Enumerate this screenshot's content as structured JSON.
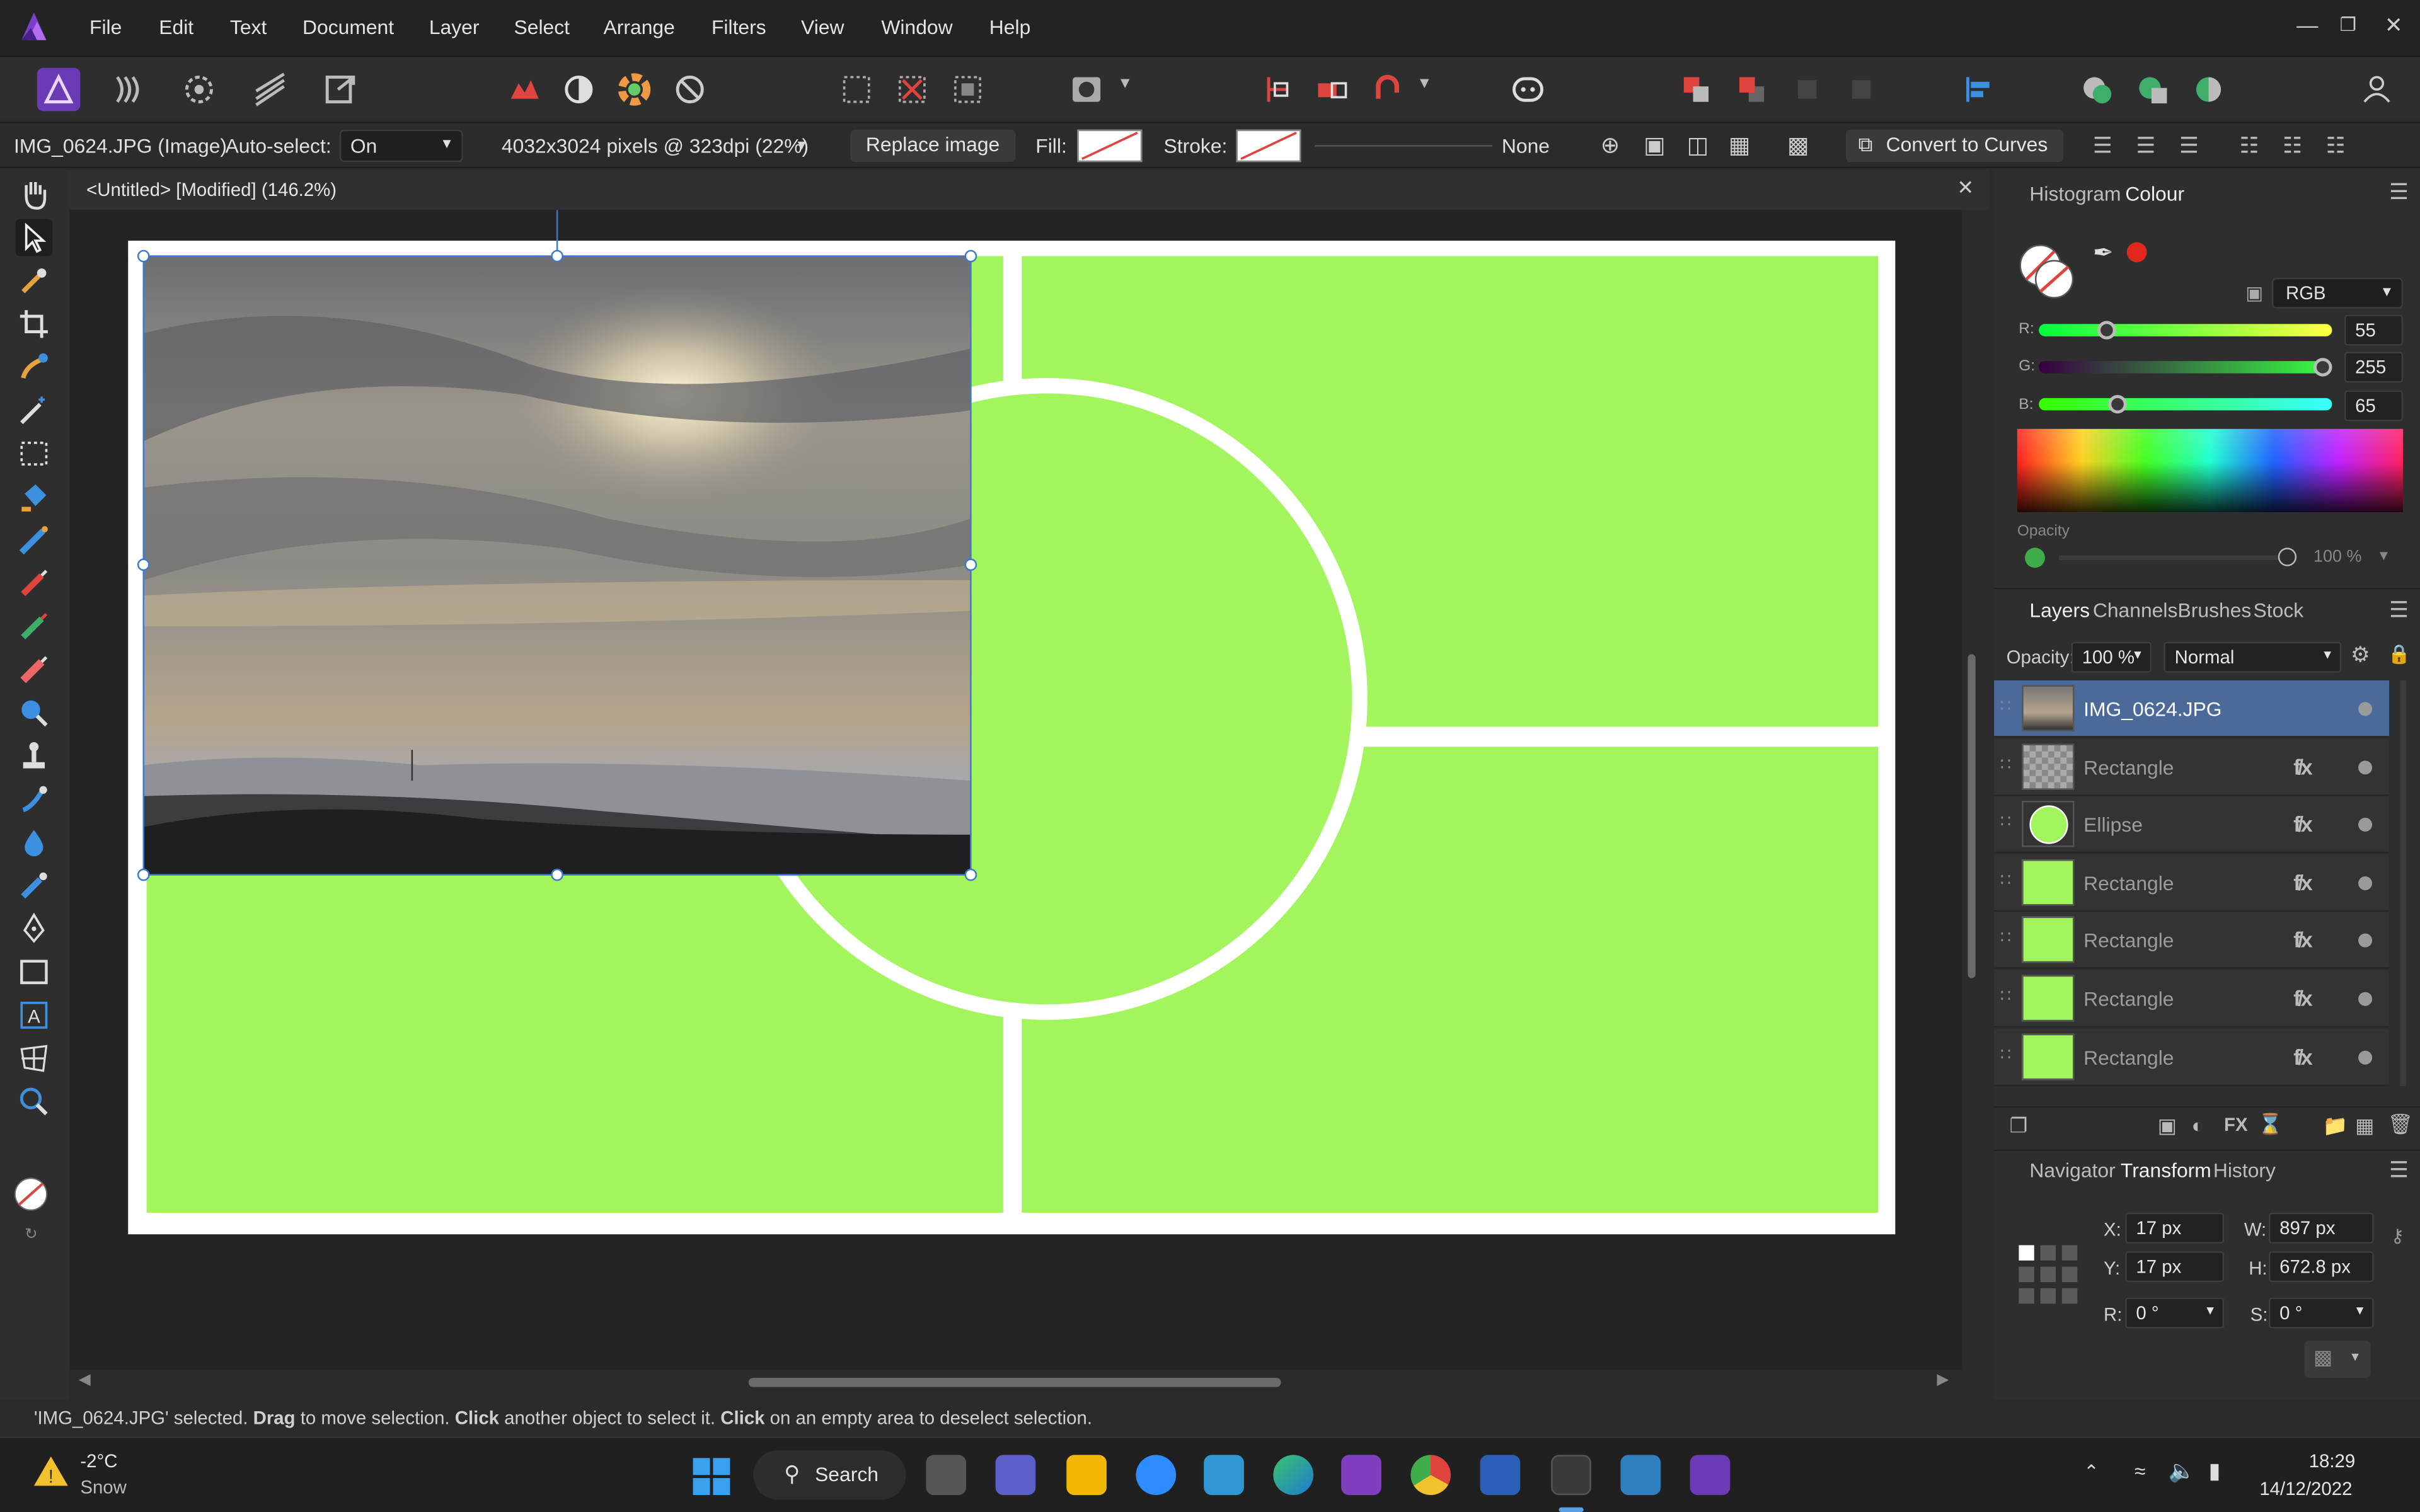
{
  "app": {
    "menu": [
      "File",
      "Edit",
      "Text",
      "Document",
      "Layer",
      "Select",
      "Arrange",
      "Filters",
      "View",
      "Window",
      "Help"
    ]
  },
  "context_bar": {
    "object_label": "IMG_0624.JPG (Image)",
    "auto_select_label": "Auto-select:",
    "auto_select_value": "On",
    "pixel_info": "4032x3024 pixels @ 323dpi (22%)",
    "replace_image": "Replace image",
    "fill_label": "Fill:",
    "stroke_label": "Stroke:",
    "stroke_width": "None",
    "convert_to_curves": "Convert to Curves"
  },
  "document": {
    "tab_title": "<Untitled> [Modified] (146.2%)",
    "accent_fill": "#a3f55d",
    "accent_selection": "#3a78d4"
  },
  "colour_panel": {
    "tabs": [
      "Histogram",
      "Colour"
    ],
    "active_tab": "Colour",
    "model": "RGB",
    "r_label": "R:",
    "r_value": "55",
    "r_fraction": 0.216,
    "g_label": "G:",
    "g_value": "255",
    "g_fraction": 1.0,
    "b_label": "B:",
    "b_value": "65",
    "b_fraction": 0.255,
    "opacity_label": "Opacity",
    "opacity_value": "100 %"
  },
  "layers_panel": {
    "tabs": [
      "Layers",
      "Channels",
      "Brushes",
      "Stock"
    ],
    "active_tab": "Layers",
    "opacity_label": "Opacity:",
    "opacity_value": "100 %",
    "blend_mode": "Normal",
    "layers": [
      {
        "name": "IMG_0624.JPG",
        "selected": true,
        "fx": false
      },
      {
        "name": "Rectangle",
        "selected": false,
        "fx": true
      },
      {
        "name": "Ellipse",
        "selected": false,
        "fx": true
      },
      {
        "name": "Rectangle",
        "selected": false,
        "fx": true
      },
      {
        "name": "Rectangle",
        "selected": false,
        "fx": true
      },
      {
        "name": "Rectangle",
        "selected": false,
        "fx": true
      },
      {
        "name": "Rectangle",
        "selected": false,
        "fx": true
      }
    ]
  },
  "transform_panel": {
    "tabs": [
      "Navigator",
      "Transform",
      "History"
    ],
    "active_tab": "Transform",
    "x_label": "X:",
    "x": "17 px",
    "y_label": "Y:",
    "y": "17 px",
    "w_label": "W:",
    "w": "897 px",
    "h_label": "H:",
    "h": "672.8 px",
    "r_label": "R:",
    "r": "0 °",
    "s_label": "S:",
    "s": "0 °"
  },
  "status": {
    "part1": "'IMG_0624.JPG' selected. ",
    "drag": "Drag",
    "part2": " to move selection. ",
    "click1": "Click",
    "part3": " another object to select it. ",
    "click2": "Click",
    "part4": " on an empty area to deselect selection."
  },
  "taskbar": {
    "weather_temp": "-2°C",
    "weather_cond": "Snow",
    "search": "Search",
    "time": "18:29",
    "date": "14/12/2022"
  }
}
